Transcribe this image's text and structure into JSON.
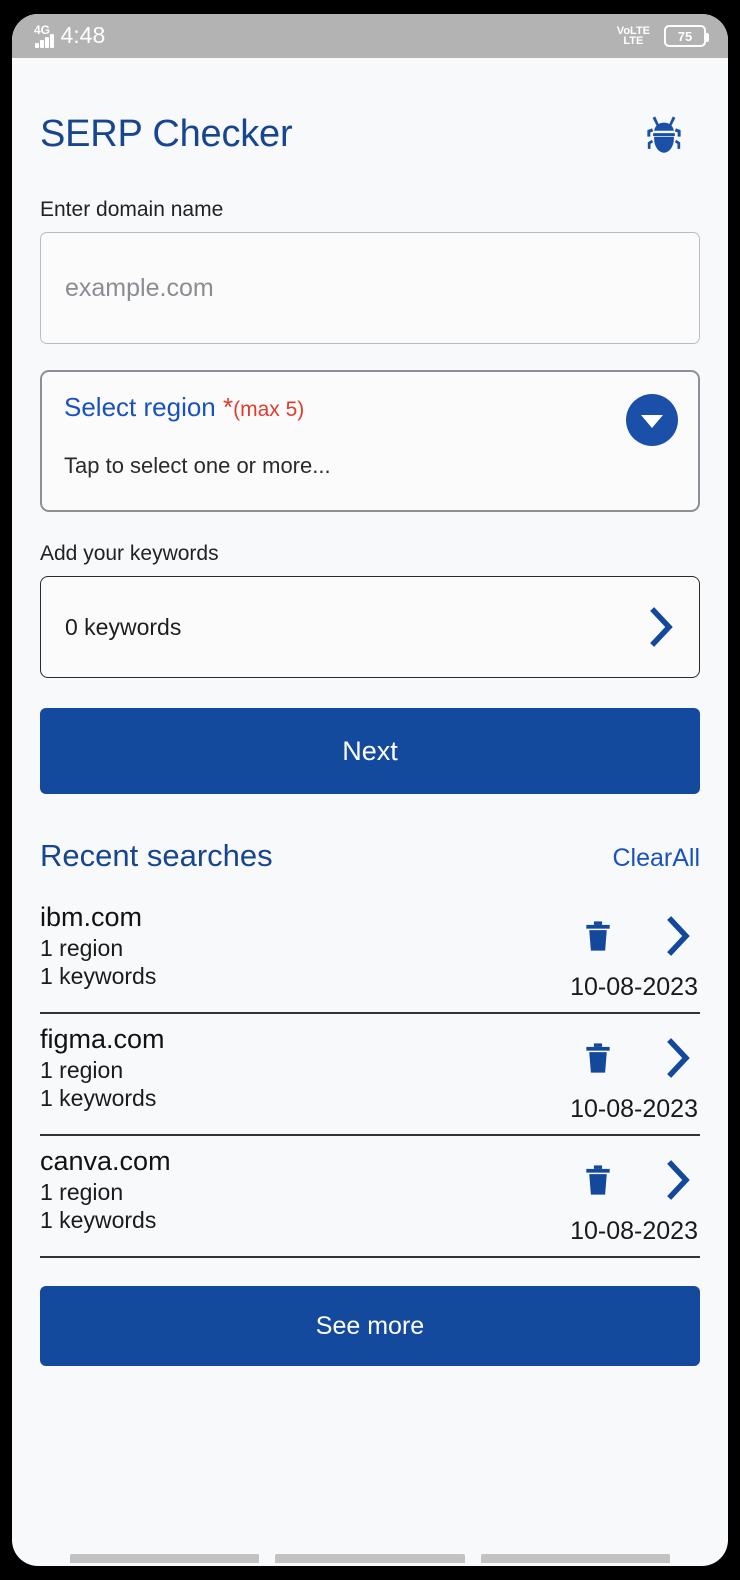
{
  "status_bar": {
    "network_type": "4G",
    "time": "4:48",
    "volte_line1": "VoLTE",
    "volte_line2": "LTE",
    "battery_level": "75",
    "signal_bars": 4
  },
  "header": {
    "app_title": "SERP Checker",
    "logo_icon": "bug-icon",
    "accent_color": "#17458f"
  },
  "domain_field": {
    "label": "Enter domain name",
    "placeholder": "example.com",
    "value": ""
  },
  "region_field": {
    "title": "Select region ",
    "required_marker": "*",
    "max_note": "(max 5)",
    "hint": "Tap to select one or more...",
    "dropdown_icon": "chevron-down-icon",
    "required_color": "#e23b2e",
    "title_color": "#1952bf"
  },
  "keywords_field": {
    "label": "Add your keywords",
    "value": "0 keywords",
    "chevron_icon": "chevron-right-icon"
  },
  "next_button": {
    "label": "Next",
    "color": "#144a9e"
  },
  "recent": {
    "title": "Recent searches",
    "clear_all_label": "ClearAll",
    "items": [
      {
        "domain": "ibm.com",
        "regions": "1 region",
        "keywords": "1 keywords",
        "date": "10-08-2023",
        "delete_icon": "trash-icon",
        "open_icon": "chevron-right-icon"
      },
      {
        "domain": "figma.com",
        "regions": "1 region",
        "keywords": "1 keywords",
        "date": "10-08-2023",
        "delete_icon": "trash-icon",
        "open_icon": "chevron-right-icon"
      },
      {
        "domain": "canva.com",
        "regions": "1 region",
        "keywords": "1 keywords",
        "date": "10-08-2023",
        "delete_icon": "trash-icon",
        "open_icon": "chevron-right-icon"
      }
    ],
    "see_more_label": "See more"
  },
  "nav_bar": {
    "segments": 3
  }
}
